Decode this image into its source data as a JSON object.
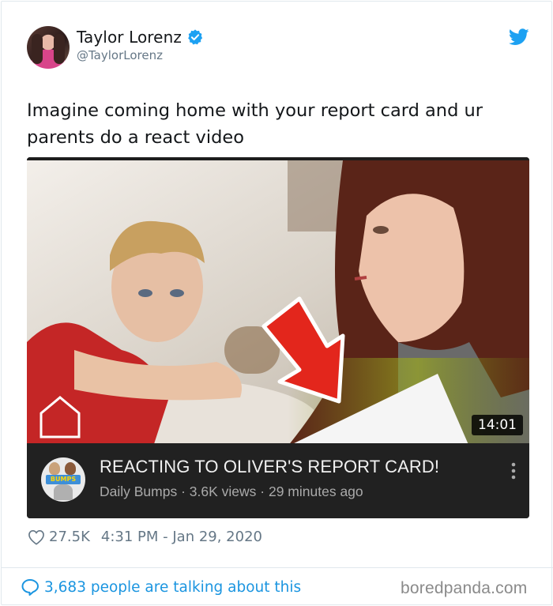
{
  "tweet": {
    "author": {
      "display_name": "Taylor Lorenz",
      "handle": "@TaylorLorenz",
      "verified": true
    },
    "text": "Imagine coming home with your report card and ur parents do a react video",
    "likes": "27.5K",
    "timestamp": "4:31 PM - Jan 29, 2020",
    "talking_about": "3,683 people are talking about this"
  },
  "video": {
    "title": "REACTING TO OLIVER'S REPORT CARD!",
    "channel": "Daily Bumps",
    "views": "3.6K views",
    "age": "29 minutes ago",
    "meta_separator": " · ",
    "duration": "14:01",
    "channel_logo_text": "BUMPS"
  },
  "watermark": "boredpanda.com",
  "icons": {
    "verified": "verified-badge-icon",
    "brand": "twitter-bird-icon",
    "like": "heart-icon",
    "reply": "speech-bubble-icon",
    "more": "vertical-ellipsis-icon",
    "arrow": "red-arrow-icon"
  },
  "colors": {
    "twitter_blue": "#1da1f2",
    "link_blue": "#1b95e0",
    "muted_text": "#657786",
    "video_bg": "#212121",
    "arrow_red": "#e3261c"
  }
}
